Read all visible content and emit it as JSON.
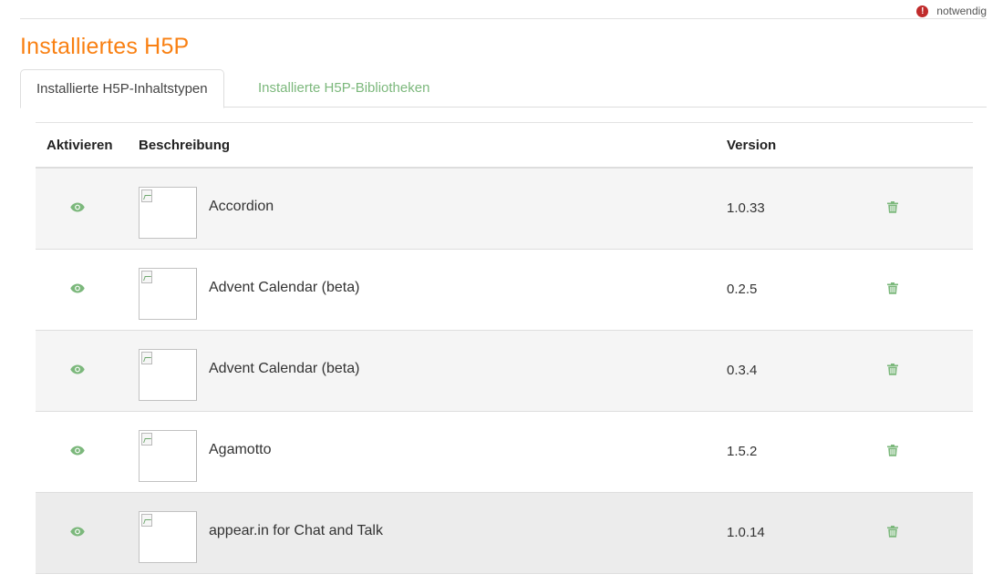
{
  "required": {
    "label": "notwendig",
    "icon": "exclamation-circle-icon",
    "color": "#c02b2b"
  },
  "page": {
    "title": "Installiertes H5P",
    "title_color": "#f98012"
  },
  "tabs": [
    {
      "label": "Installierte H5P-Inhaltstypen",
      "active": true
    },
    {
      "label": "Installierte H5P-Bibliotheken",
      "active": false
    }
  ],
  "accent_color": "#7cb87c",
  "table": {
    "headers": {
      "activate": "Aktivieren",
      "description": "Beschreibung",
      "version": "Version"
    },
    "rows": [
      {
        "name": "Accordion",
        "version": "1.0.33",
        "icon": "eye-icon",
        "action_icon": "trash-icon"
      },
      {
        "name": "Advent Calendar (beta)",
        "version": "0.2.5",
        "icon": "eye-icon",
        "action_icon": "trash-icon"
      },
      {
        "name": "Advent Calendar (beta)",
        "version": "0.3.4",
        "icon": "eye-icon",
        "action_icon": "trash-icon"
      },
      {
        "name": "Agamotto",
        "version": "1.5.2",
        "icon": "eye-icon",
        "action_icon": "trash-icon"
      },
      {
        "name": "appear.in for Chat and Talk",
        "version": "1.0.14",
        "icon": "eye-icon",
        "action_icon": "trash-icon"
      }
    ]
  }
}
